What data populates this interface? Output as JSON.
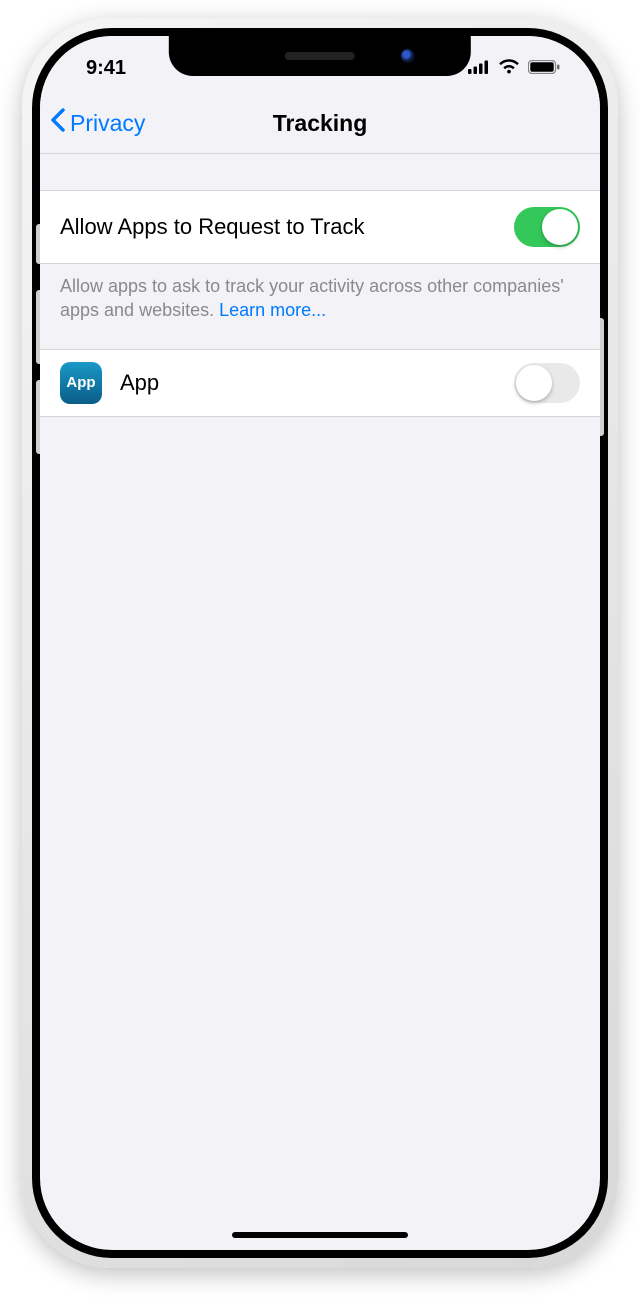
{
  "status": {
    "time": "9:41"
  },
  "nav": {
    "back_label": "Privacy",
    "title": "Tracking"
  },
  "allow_track": {
    "label": "Allow Apps to Request to Track",
    "enabled": true,
    "footer": "Allow apps to ask to track your activity across other companies' apps and websites. ",
    "learn_more": "Learn more..."
  },
  "apps": [
    {
      "icon_text": "App",
      "name": "App",
      "enabled": false
    }
  ]
}
